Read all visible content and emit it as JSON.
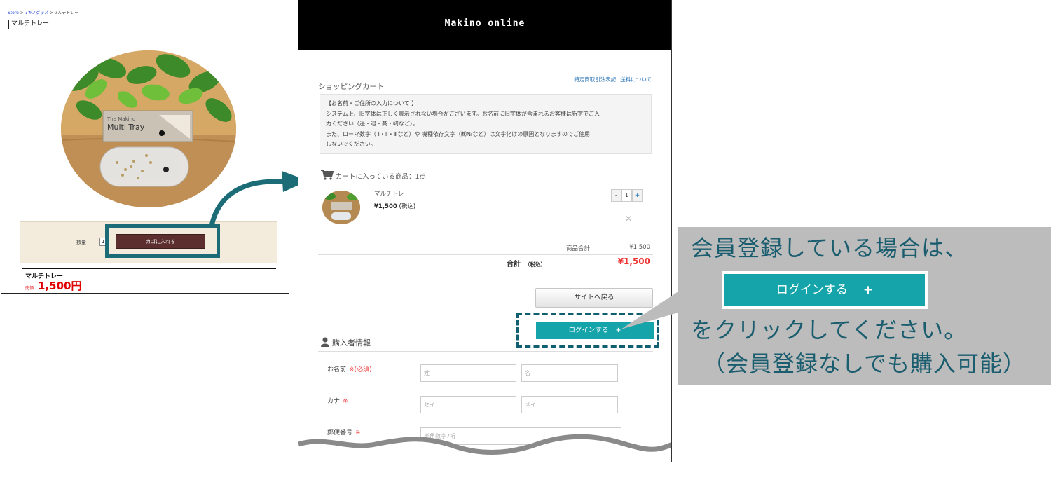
{
  "store": {
    "breadcrumb": {
      "home": "Store",
      "sep1": " >",
      "category": "マキノグッズ",
      "sep2": " >",
      "current": "マルチトレー"
    },
    "title": "マルチトレー",
    "qty_label": "数量",
    "qty_value": "1",
    "add_to_cart_label": "カゴに入れる",
    "product_name": "マルチトレー",
    "price_label": "売価：",
    "price_value": "1,500円",
    "photo_box_brand": "Multi Tray",
    "photo_box_small": "The Makino"
  },
  "checkout": {
    "logo": "Makino online",
    "links": [
      "特定商取引法表記",
      "送料について"
    ],
    "cart_title": "ショッピングカート",
    "notice": [
      "【お名前・ご住所の入力について 】",
      "システム上、旧字体は正しく表示されない場合がございます。お名前に旧字体が含まれるお客様は新字でご入",
      "力ください（邊・邉・髙・﨑など）。",
      "また、ローマ数字（ Ⅰ・Ⅱ・Ⅲなど）や 機種依存文字（㈱№など）は文字化けの原因となりますのでご使用",
      "しないでください。"
    ],
    "cart_items_heading": "カートに入っている商品：1点",
    "item": {
      "name": "マルチトレー",
      "price": "¥1,500",
      "tax_note": "(税込)",
      "qty": "1",
      "minus": "-",
      "plus": "+",
      "remove": "✕"
    },
    "subtotal_label": "商品合計",
    "subtotal_value": "¥1,500",
    "total_label": "合計",
    "total_tax": "（税込）",
    "total_value": "¥1,500",
    "back_button": "サイトへ戻る",
    "login_button": "ログインする",
    "login_plus": "+",
    "buyer_heading": "購入者情報",
    "form": {
      "name_label": "お名前",
      "name_req": "※(必須)",
      "last_name_ph": "姓",
      "first_name_ph": "名",
      "kana_label": "カナ",
      "kana_req": "※",
      "last_kana_ph": "セイ",
      "first_kana_ph": "メイ",
      "zip_label": "郵便番号",
      "zip_req": "※",
      "zip_ph": "半角数字7桁"
    }
  },
  "callout": {
    "line1": "会員登録している場合は、",
    "button": "ログインする",
    "button_plus": "+",
    "line2": "をクリックしてください。",
    "line3": "（会員登録なしでも購入可能）"
  },
  "colors": {
    "teal_button": "#16a4ab",
    "callout_text": "#1a5d6f",
    "callout_bg": "#bcbcbc",
    "highlight": "#1c6c78",
    "cart_button": "#5c2e2e",
    "price_red": "#e00000"
  }
}
